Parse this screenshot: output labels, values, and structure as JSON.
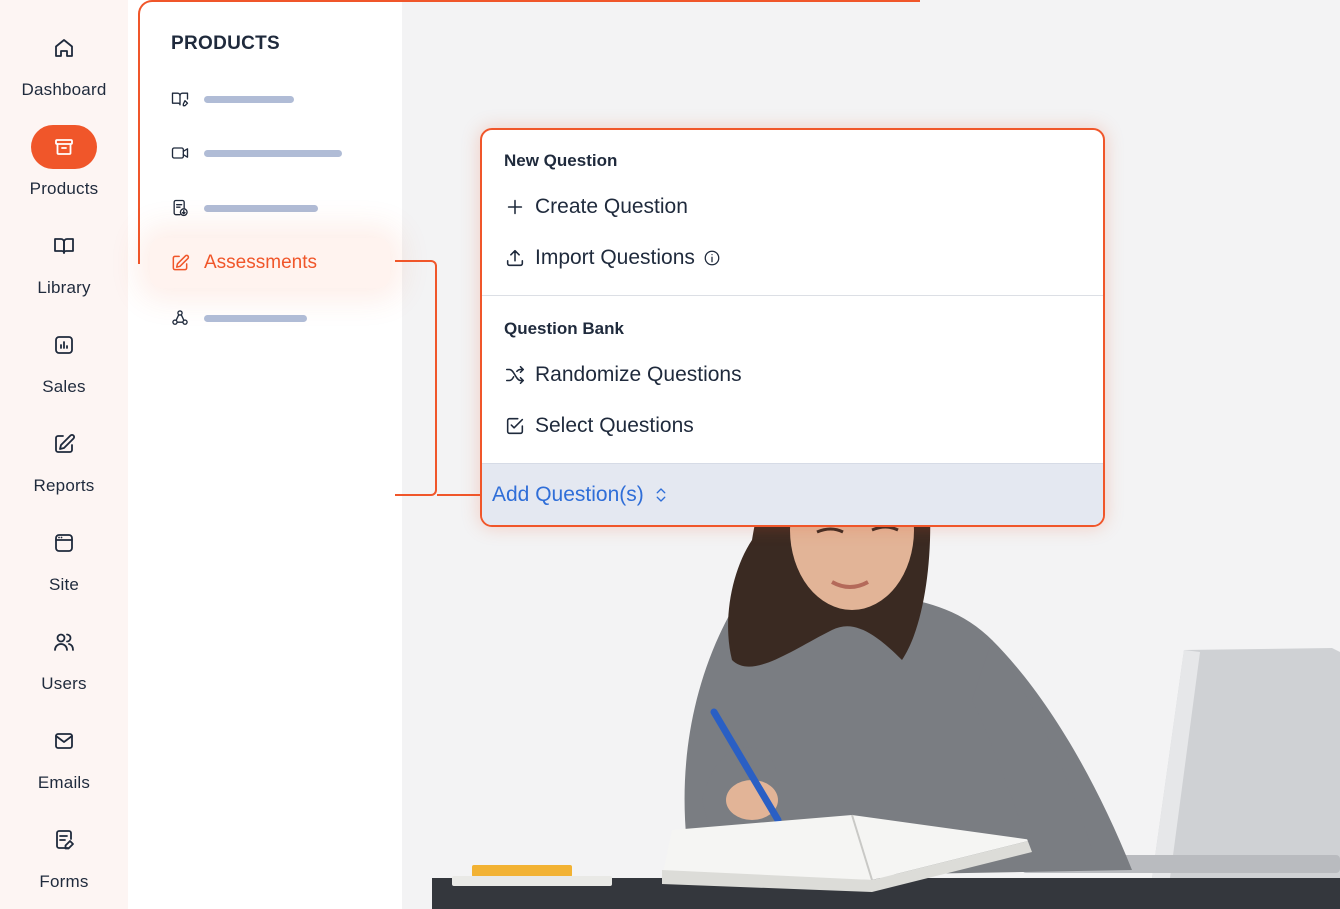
{
  "rail": {
    "items": [
      {
        "label": "Dashboard",
        "icon": "home-icon"
      },
      {
        "label": "Products",
        "icon": "archive-icon",
        "active": true
      },
      {
        "label": "Library",
        "icon": "book-icon"
      },
      {
        "label": "Sales",
        "icon": "chart-icon"
      },
      {
        "label": "Reports",
        "icon": "edit-icon"
      },
      {
        "label": "Site",
        "icon": "browser-icon"
      },
      {
        "label": "Users",
        "icon": "users-icon"
      },
      {
        "label": "Emails",
        "icon": "mail-icon"
      },
      {
        "label": "Forms",
        "icon": "form-icon"
      }
    ]
  },
  "products": {
    "title": "PRODUCTS",
    "active_item": "Assessments"
  },
  "menu": {
    "new_question": {
      "title": "New Question",
      "create": "Create Question",
      "import": "Import Questions"
    },
    "question_bank": {
      "title": "Question Bank",
      "randomize": "Randomize Questions",
      "select": "Select Questions"
    },
    "footer_button": "Add Question(s)"
  },
  "colors": {
    "accent": "#f0562a",
    "link": "#2f6ed8",
    "text": "#1f2a3c",
    "placeholder_bar": "#b0bcd6"
  }
}
